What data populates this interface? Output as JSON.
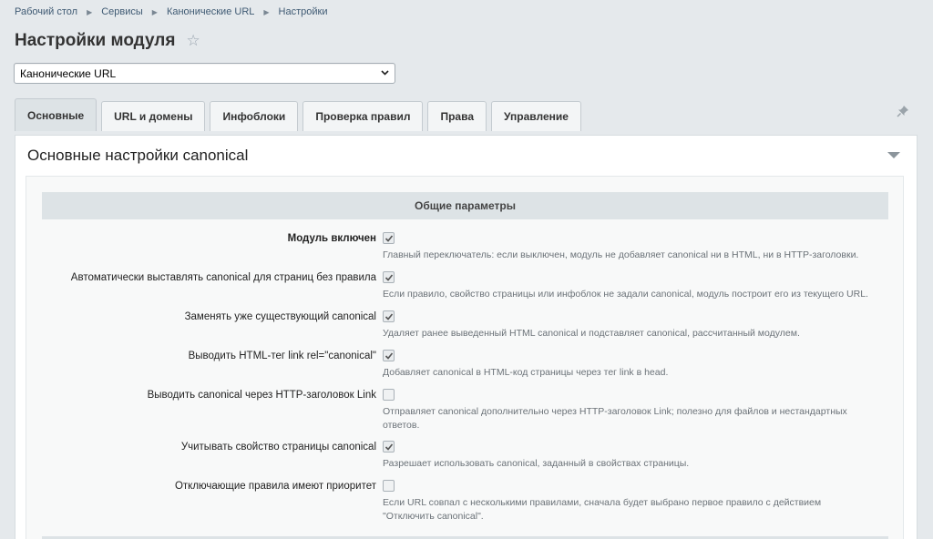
{
  "breadcrumb": {
    "items": [
      "Рабочий стол",
      "Сервисы",
      "Канонические URL",
      "Настройки"
    ]
  },
  "page": {
    "title": "Настройки модуля"
  },
  "module_select": {
    "value": "Канонические URL"
  },
  "tabs": [
    {
      "label": "Основные",
      "active": true
    },
    {
      "label": "URL и домены",
      "active": false
    },
    {
      "label": "Инфоблоки",
      "active": false
    },
    {
      "label": "Проверка правил",
      "active": false
    },
    {
      "label": "Права",
      "active": false
    },
    {
      "label": "Управление",
      "active": false
    }
  ],
  "panel": {
    "title": "Основные настройки canonical",
    "section_title": "Общие параметры"
  },
  "settings": [
    {
      "label": "Модуль включен",
      "checked": true,
      "hint": "Главный переключатель: если выключен, модуль не добавляет canonical ни в HTML, ни в HTTP-заголовки."
    },
    {
      "label": "Автоматически выставлять canonical для страниц без правила",
      "checked": true,
      "hint": "Если правило, свойство страницы или инфоблок не задали canonical, модуль построит его из текущего URL."
    },
    {
      "label": "Заменять уже существующий canonical",
      "checked": true,
      "hint": "Удаляет ранее выведенный HTML canonical и подставляет canonical, рассчитанный модулем."
    },
    {
      "label": "Выводить HTML-тег link rel=\"canonical\"",
      "checked": true,
      "hint": "Добавляет canonical в HTML-код страницы через тег link в head."
    },
    {
      "label": "Выводить canonical через HTTP-заголовок Link",
      "checked": false,
      "hint": "Отправляет canonical дополнительно через HTTP-заголовок Link; полезно для файлов и нестандартных ответов."
    },
    {
      "label": "Учитывать свойство страницы canonical",
      "checked": true,
      "hint": "Разрешает использовать canonical, заданный в свойствах страницы."
    },
    {
      "label": "Отключающие правила имеют приоритет",
      "checked": false,
      "hint": "Если URL совпал с несколькими правилами, сначала будет выбрано первое правило с действием \"Отключить canonical\"."
    }
  ],
  "icons": {
    "star": "star-icon",
    "pin": "pin-icon",
    "collapse": "triangle-down-icon",
    "select": "chevron-down-icon",
    "check": "checkmark-icon"
  }
}
